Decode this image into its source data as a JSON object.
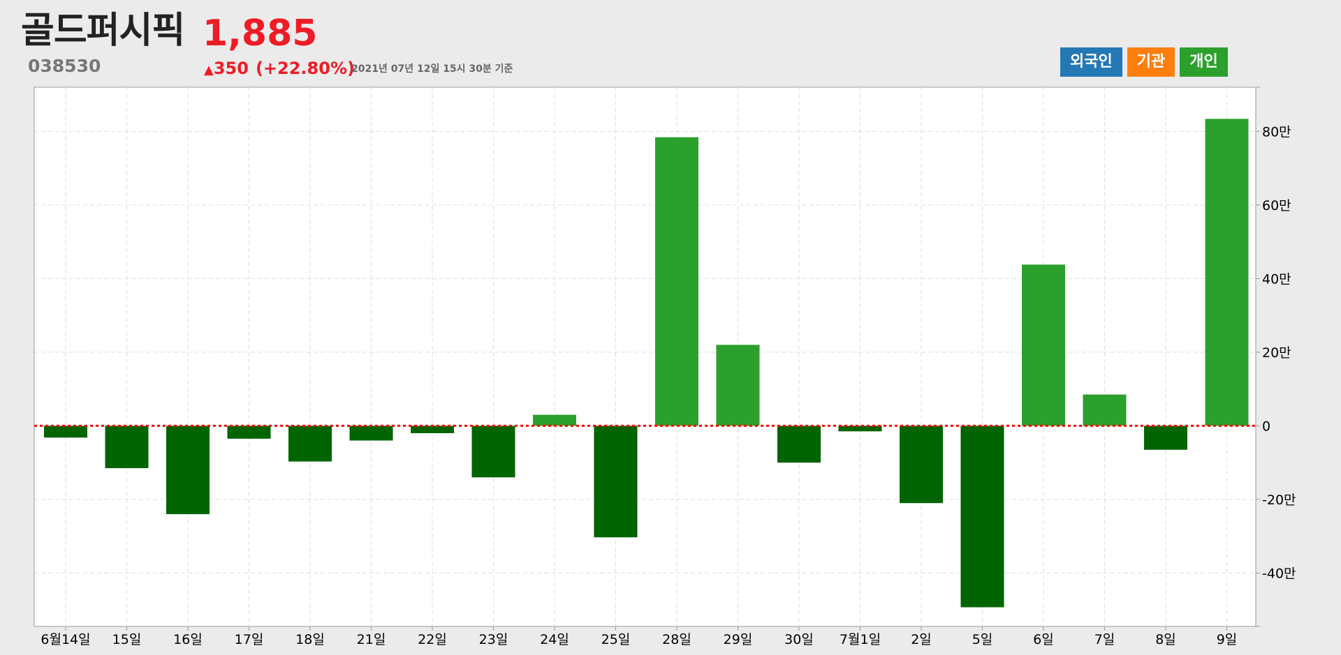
{
  "stock": {
    "name": "골드퍼시픽",
    "price": "1,885",
    "code": "038530",
    "change_arrow": "▲",
    "change_value": "350",
    "change_pct": "(+22.80%)",
    "as_of": "2021년 07년 12일 15시 30분 기준"
  },
  "legend": {
    "foreign": {
      "label": "외국인",
      "color": "#2378b5"
    },
    "institution": {
      "label": "기관",
      "color": "#fe7f0e"
    },
    "individual": {
      "label": "개인",
      "color": "#2ca02c"
    }
  },
  "colors": {
    "positive_bar": "#2ca02c",
    "negative_bar": "#006400",
    "up": "#ee1c25",
    "zero_line": "#ff0000"
  },
  "chart_data": {
    "type": "bar",
    "categories": [
      "6월14일",
      "15일",
      "16일",
      "17일",
      "18일",
      "21일",
      "22일",
      "23일",
      "24일",
      "25일",
      "28일",
      "29일",
      "30일",
      "7월1일",
      "2일",
      "5일",
      "6일",
      "7일",
      "8일",
      "9일"
    ],
    "series": [
      {
        "name": "개인",
        "values": [
          -32000,
          -115000,
          -240000,
          -35000,
          -97000,
          -40000,
          -20000,
          -140000,
          30000,
          -303000,
          784000,
          220000,
          -100000,
          -15000,
          -210000,
          -493000,
          438000,
          85000,
          -65000,
          834000
        ]
      }
    ],
    "ylim": [
      -545000,
      920000
    ],
    "yticks": [
      80,
      60,
      40,
      20,
      0,
      -20,
      -40
    ],
    "ytick_labels": [
      "80만",
      "60만",
      "40만",
      "20만",
      "0",
      "-20만",
      "-40만"
    ],
    "ytick_unit": 10000,
    "grid": true,
    "zero_line": "dotted"
  }
}
